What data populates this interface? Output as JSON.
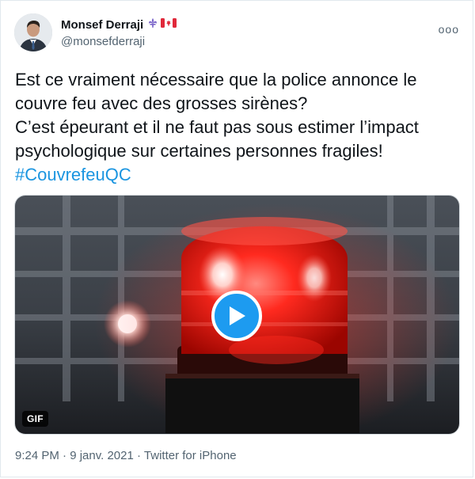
{
  "author": {
    "name": "Monsef Derraji",
    "handle": "@monsefderraji",
    "flags": [
      "fleur-de-lis-flag",
      "canada-flag"
    ]
  },
  "more_icon": "ooo",
  "tweet": {
    "lines": [
      "Est ce vraiment nécessaire que la police annonce le",
      "couvre feu avec des grosses sirènes?",
      "C’est épeurant et il ne faut pas sous estimer l’impact",
      "psychologique sur certaines personnes fragiles!"
    ],
    "hashtag": "#CouvrefeuQC"
  },
  "media": {
    "badge": "GIF",
    "play_icon": "play-icon",
    "accent": "#1d9bf0"
  },
  "meta": {
    "time": "9:24 PM",
    "separator": "·",
    "date": "9 janv. 2021",
    "source": "Twitter for iPhone"
  },
  "colors": {
    "text": "#0f1419",
    "secondary": "#536471",
    "link": "#1b95e0"
  }
}
